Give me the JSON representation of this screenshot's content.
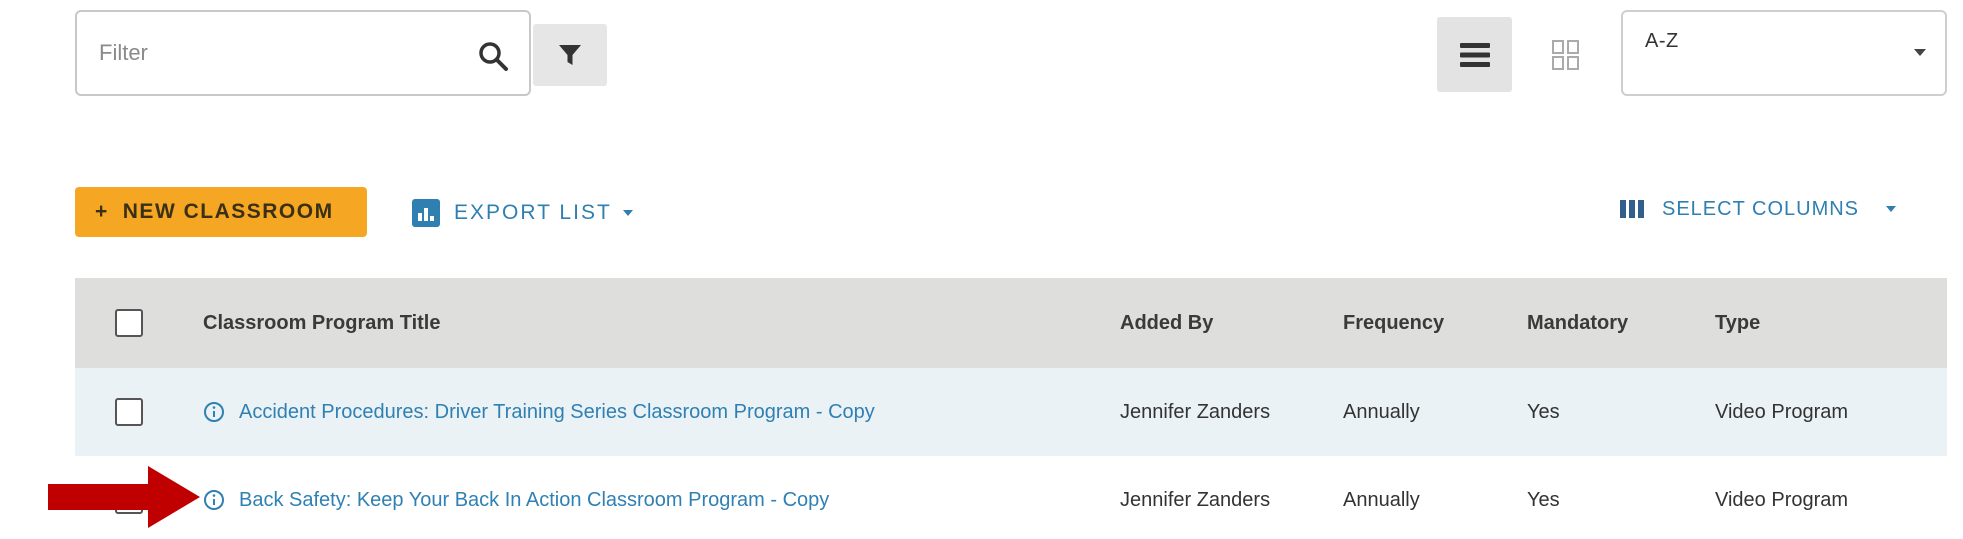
{
  "toolbar": {
    "filter_placeholder": "Filter",
    "sort_value": "A-Z"
  },
  "actions": {
    "new_classroom_plus": "+",
    "new_classroom_label": "NEW CLASSROOM",
    "export_label": "EXPORT LIST",
    "select_columns_label": "SELECT COLUMNS"
  },
  "table": {
    "columns": {
      "title": "Classroom Program Title",
      "added_by": "Added By",
      "frequency": "Frequency",
      "mandatory": "Mandatory",
      "type": "Type"
    },
    "rows": [
      {
        "title": "Accident Procedures: Driver Training Series Classroom Program - Copy",
        "added_by": "Jennifer Zanders",
        "frequency": "Annually",
        "mandatory": "Yes",
        "type": "Video Program"
      },
      {
        "title": "Back Safety: Keep Your Back In Action Classroom Program - Copy",
        "added_by": "Jennifer Zanders",
        "frequency": "Annually",
        "mandatory": "Yes",
        "type": "Video Program"
      }
    ]
  },
  "colors": {
    "accent_orange": "#f5a623",
    "link_blue": "#2f80b3",
    "header_gray": "#dededc",
    "row_shaded": "#eaf2f5",
    "annotation_red": "#c00000"
  },
  "icons": {
    "search": "search-icon",
    "filter": "funnel-icon",
    "list_view": "list-view-icon",
    "grid_view": "grid-view-icon",
    "export": "chart-icon",
    "columns": "columns-icon",
    "info": "info-icon",
    "annotation": "red-arrow-icon"
  }
}
